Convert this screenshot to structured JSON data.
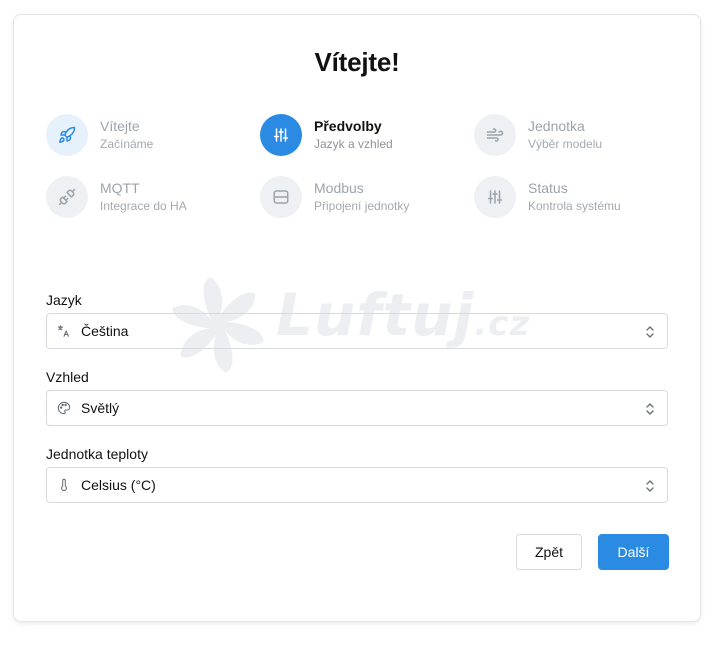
{
  "title": "Vítejte!",
  "steps": [
    {
      "title": "Vítejte",
      "subtitle": "Začínáme",
      "icon": "rocket-icon",
      "state": "done"
    },
    {
      "title": "Předvolby",
      "subtitle": "Jazyk a vzhled",
      "icon": "sliders-icon",
      "state": "active"
    },
    {
      "title": "Jednotka",
      "subtitle": "Výběr modelu",
      "icon": "wind-icon",
      "state": "pending"
    },
    {
      "title": "MQTT",
      "subtitle": "Integrace do HA",
      "icon": "plug-icon",
      "state": "pending"
    },
    {
      "title": "Modbus",
      "subtitle": "Připojení jednotky",
      "icon": "server-icon",
      "state": "pending"
    },
    {
      "title": "Status",
      "subtitle": "Kontrola systému",
      "icon": "sliders-icon",
      "state": "pending"
    }
  ],
  "watermark": {
    "brand": "Luftuj",
    "domain": ".cz"
  },
  "fields": {
    "language": {
      "label": "Jazyk",
      "value": "Čeština",
      "icon": "language-icon"
    },
    "theme": {
      "label": "Vzhled",
      "value": "Světlý",
      "icon": "palette-icon"
    },
    "temperature_unit": {
      "label": "Jednotka teploty",
      "value": "Celsius (°C)",
      "icon": "thermometer-icon"
    }
  },
  "buttons": {
    "back": "Zpět",
    "next": "Další"
  },
  "colors": {
    "accent": "#2b8ae2",
    "done_bg": "#e6f1fc",
    "pending_bg": "#eef0f3"
  }
}
